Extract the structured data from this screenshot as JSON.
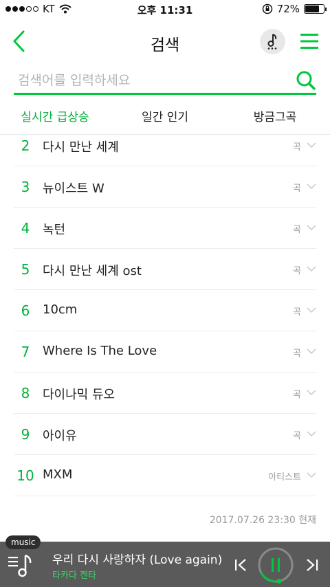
{
  "status_bar": {
    "carrier": "KT",
    "time": "오후 11:31",
    "battery": "72%",
    "battery_level": 0.72
  },
  "header": {
    "title": "검색",
    "back_icon": "chevron-left-icon",
    "note_icon": "music-note-icon",
    "menu_icon": "hamburger-menu-icon"
  },
  "search": {
    "placeholder": "검색어를 입력하세요",
    "value": ""
  },
  "tabs": [
    {
      "label": "실시간 급상승",
      "active": true
    },
    {
      "label": "일간 인기",
      "active": false
    },
    {
      "label": "방금그곡",
      "active": false
    }
  ],
  "rankings": [
    {
      "rank": "2",
      "name": "다시 만난 세계",
      "type": "곡"
    },
    {
      "rank": "3",
      "name": "뉴이스트 W",
      "type": "곡"
    },
    {
      "rank": "4",
      "name": "녹턴",
      "type": "곡"
    },
    {
      "rank": "5",
      "name": "다시 만난 세계 ost",
      "type": "곡"
    },
    {
      "rank": "6",
      "name": "10cm",
      "type": "곡"
    },
    {
      "rank": "7",
      "name": "Where Is The Love",
      "type": "곡"
    },
    {
      "rank": "8",
      "name": "다이나믹 듀오",
      "type": "곡"
    },
    {
      "rank": "9",
      "name": "아이유",
      "type": "곡"
    },
    {
      "rank": "10",
      "name": "MXM",
      "type": "아티스트"
    }
  ],
  "timestamp": "2017.07.26 23:30 현재",
  "player": {
    "badge": "music",
    "song": "우리 다시 사랑하자 (Love again)",
    "artist": "타카다 켄타",
    "accent": "#00c73c"
  },
  "colors": {
    "accent": "#00c73c",
    "rank_green": "#00b23a"
  }
}
